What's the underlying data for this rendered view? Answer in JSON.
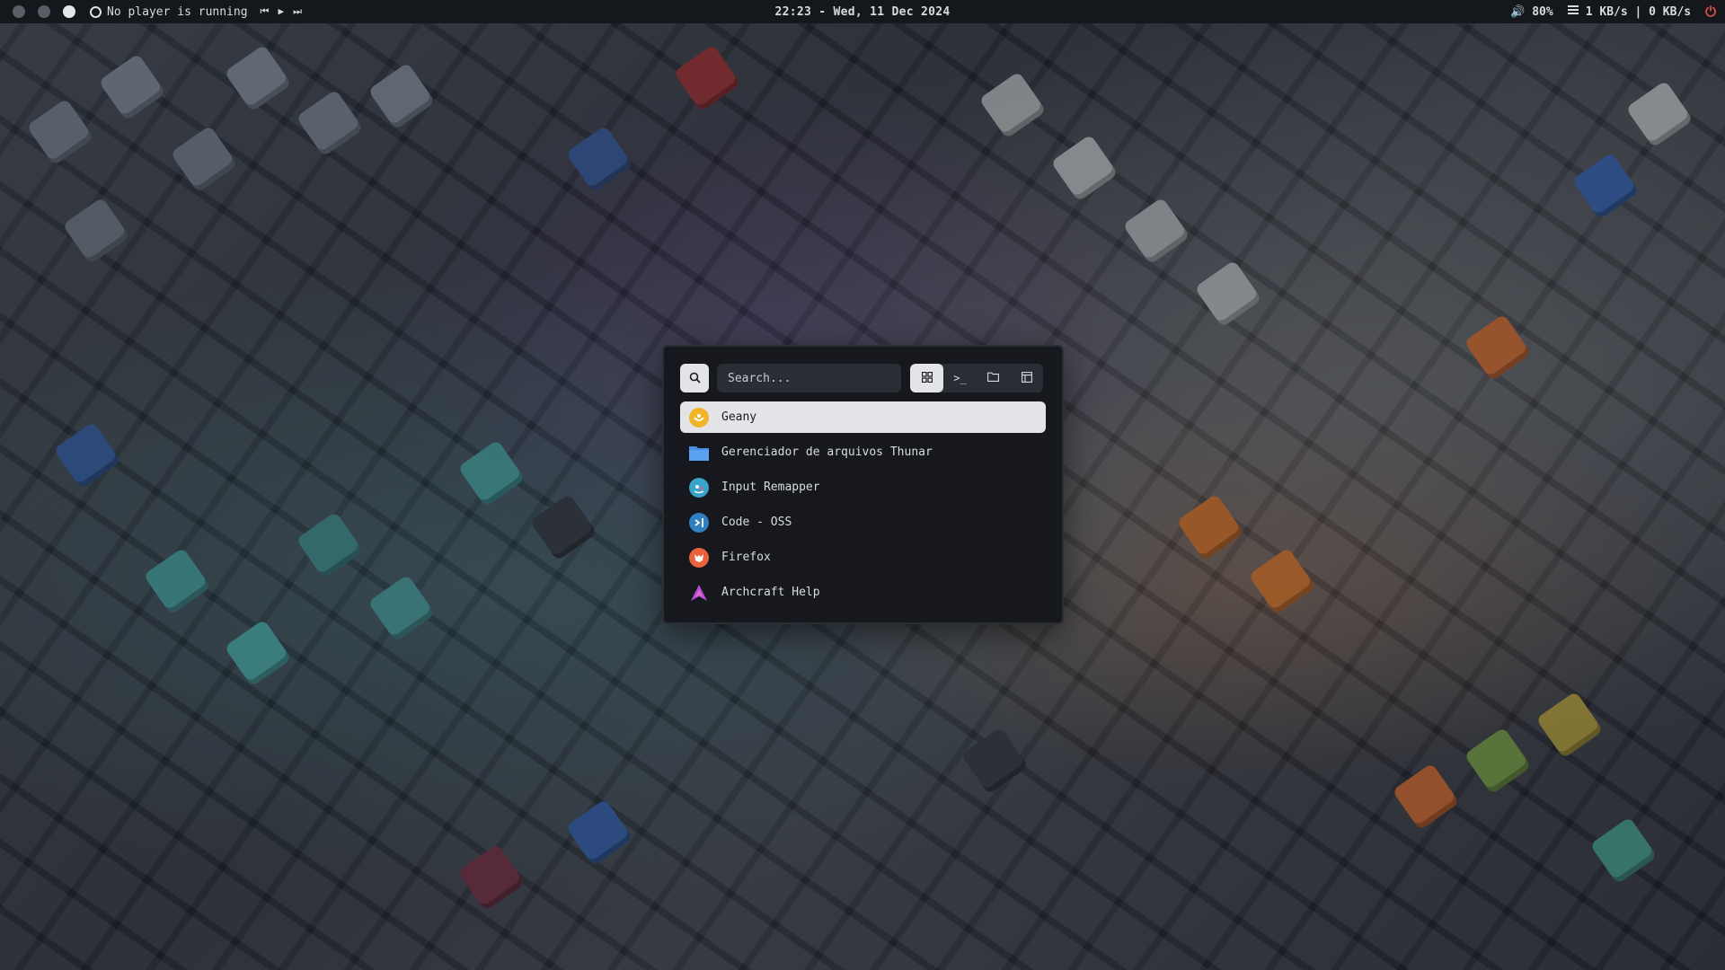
{
  "topbar": {
    "player_status": "No player is running",
    "clock": "22:23 - Wed, 11 Dec 2024",
    "volume": "80%",
    "network": "1 KB/s | 0 KB/s",
    "icons": [
      "workspace-dot",
      "music-icon",
      "prev-icon",
      "play-icon",
      "next-icon",
      "volume-icon",
      "network-icon",
      "power-icon"
    ]
  },
  "launcher": {
    "search": {
      "placeholder": "Search...",
      "value": ""
    },
    "modes": [
      {
        "name": "apps",
        "icon": "grid-icon",
        "active": true
      },
      {
        "name": "run",
        "icon": "terminal-icon",
        "active": false
      },
      {
        "name": "files",
        "icon": "folder-icon",
        "active": false
      },
      {
        "name": "windows",
        "icon": "window-icon",
        "active": false
      }
    ],
    "items": [
      {
        "label": "Geany",
        "icon": "geany-icon",
        "selected": true,
        "color": "#f0b429"
      },
      {
        "label": "Gerenciador de arquivos Thunar",
        "icon": "folder-icon",
        "selected": false,
        "color": "#4a90e2"
      },
      {
        "label": "Input Remapper",
        "icon": "input-remapper-icon",
        "selected": false,
        "color": "#3aa3c8"
      },
      {
        "label": "Code - OSS",
        "icon": "vscode-icon",
        "selected": false,
        "color": "#2f7fc1"
      },
      {
        "label": "Firefox",
        "icon": "firefox-icon",
        "selected": false,
        "color": "#e8623a"
      },
      {
        "label": "Archcraft Help",
        "icon": "archcraft-icon",
        "selected": false,
        "color": "#b44cd8"
      }
    ]
  },
  "colors": {
    "bar_bg": "#14171c",
    "launcher_bg": "#16181d",
    "selected_bg": "#e2e4e8",
    "power": "#e0504a"
  }
}
